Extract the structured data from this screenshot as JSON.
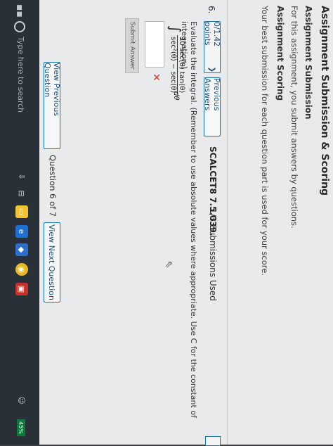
{
  "header": {
    "title": "Assignment Submission & Scoring",
    "submission_heading": "Assignment Submission",
    "submission_text": "For this assignment, you submit answers by questions.",
    "scoring_heading": "Assignment Scoring",
    "scoring_text": "Your best submission for each question part is used for your score."
  },
  "question": {
    "number": "6.",
    "points_label": "0/1.42 points",
    "previous_answers_label": "Previous Answers",
    "code": "SCALCET8 7.5.039.",
    "submissions": "1/3 Submissions Used",
    "prompt": "Evaluate the integral. (Remember to use absolute values where appropriate. Use C for the constant of integration.)",
    "integral_symbol": "∫",
    "numerator": "10 sec(θ) tan(θ)",
    "denominator": "sec²(θ) − sec(θ)",
    "differential": "dθ",
    "wrong_mark": "✕",
    "submit_label": "Submit Answer"
  },
  "nav": {
    "view_previous": "View Previous Question",
    "position": "Question 6 of 7",
    "view_next": "View Next Question"
  },
  "taskbar": {
    "search_placeholder": "Type here to search",
    "battery": "45%"
  }
}
